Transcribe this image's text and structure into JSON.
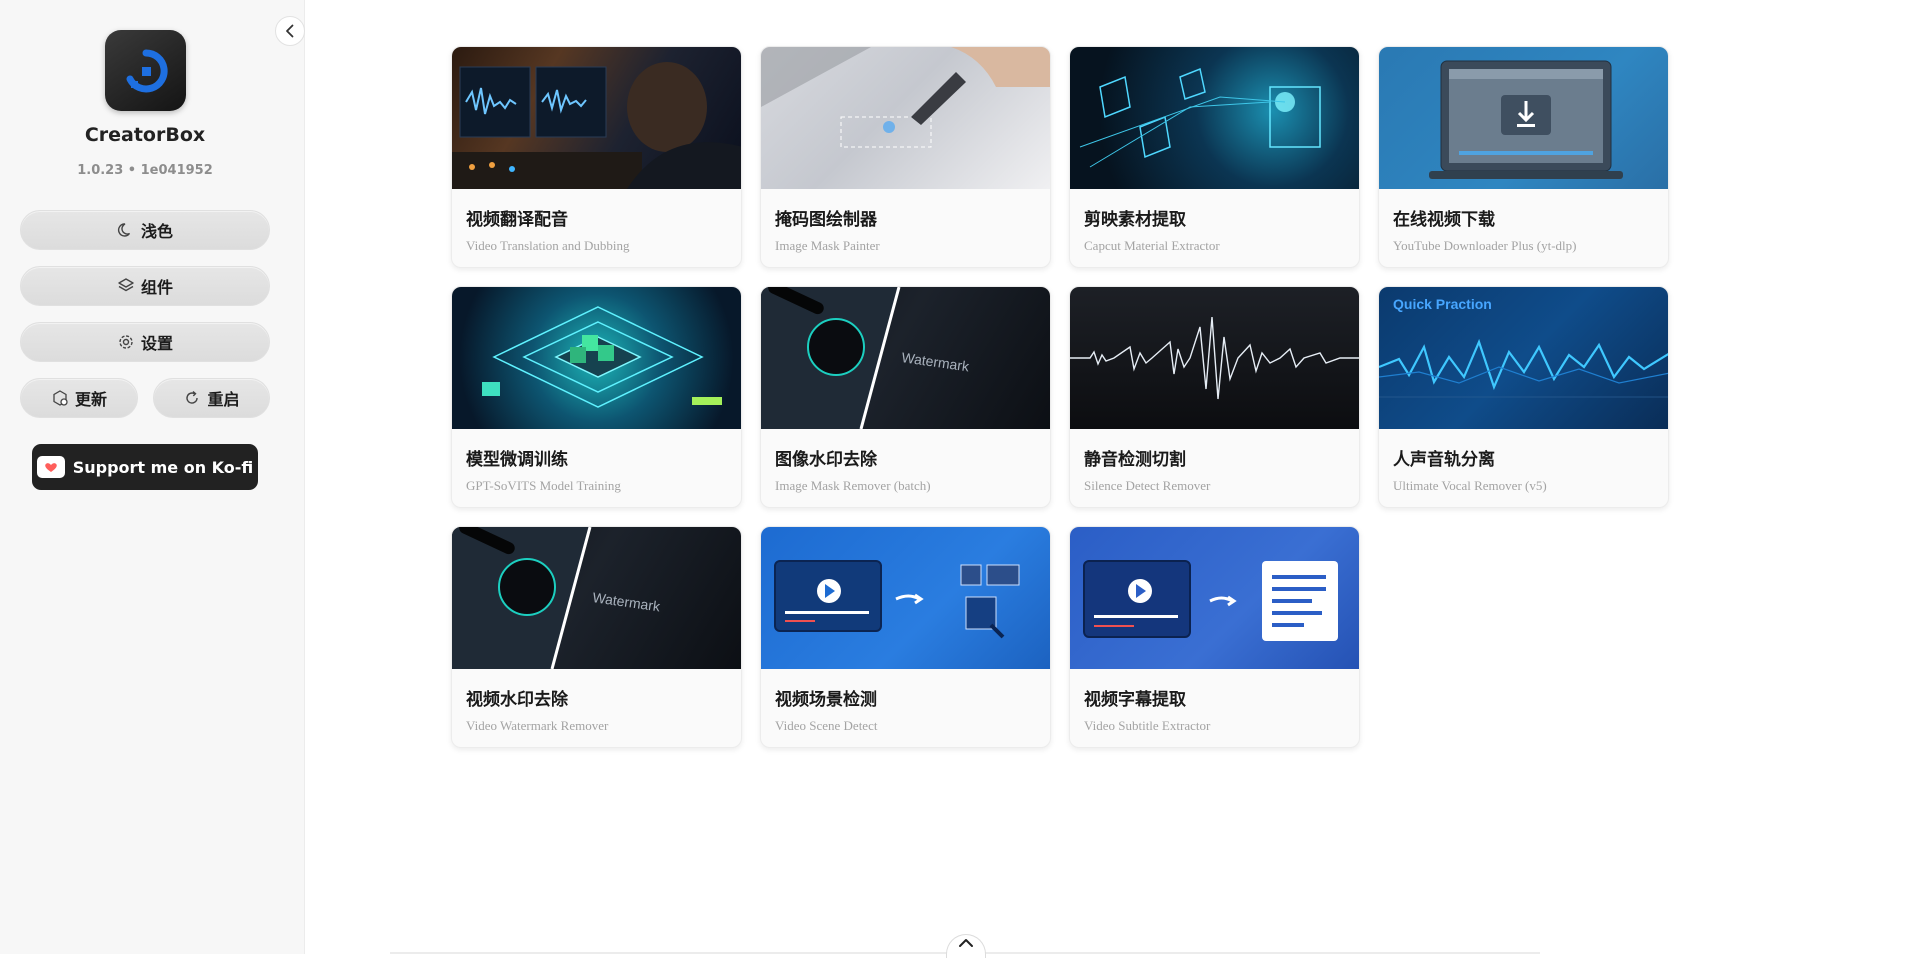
{
  "sidebar": {
    "app_name": "CreatorBox",
    "version": "1.0.23 • 1e041952",
    "buttons": {
      "theme": "浅色",
      "components": "组件",
      "settings": "设置",
      "update": "更新",
      "restart": "重启"
    },
    "kofi_label": "Support me on Ko-fi",
    "collapse_icon": "chevron-left-icon"
  },
  "tools": [
    {
      "title": "视频翻译配音",
      "subtitle": "Video Translation and Dubbing"
    },
    {
      "title": "掩码图绘制器",
      "subtitle": "Image Mask Painter"
    },
    {
      "title": "剪映素材提取",
      "subtitle": "Capcut Material Extractor"
    },
    {
      "title": "在线视频下载",
      "subtitle": "YouTube Downloader Plus (yt-dlp)"
    },
    {
      "title": "模型微调训练",
      "subtitle": "GPT-SoVITS Model Training"
    },
    {
      "title": "图像水印去除",
      "subtitle": "Image Mask Remover (batch)"
    },
    {
      "title": "静音检测切割",
      "subtitle": "Silence Detect Remover"
    },
    {
      "title": "人声音轨分离",
      "subtitle": "Ultimate Vocal Remover (v5)"
    },
    {
      "title": "视频水印去除",
      "subtitle": "Video Watermark Remover"
    },
    {
      "title": "视频场景检测",
      "subtitle": "Video Scene Detect"
    },
    {
      "title": "视频字幕提取",
      "subtitle": "Video Subtitle Extractor"
    }
  ],
  "thumb_text": {
    "watermark": "Watermark",
    "quick_practice": "Quick Praction"
  },
  "colors": {
    "accent": "#1e6fe0",
    "sidebar_bg": "#f7f7f7",
    "kofi_bg": "#222222"
  }
}
